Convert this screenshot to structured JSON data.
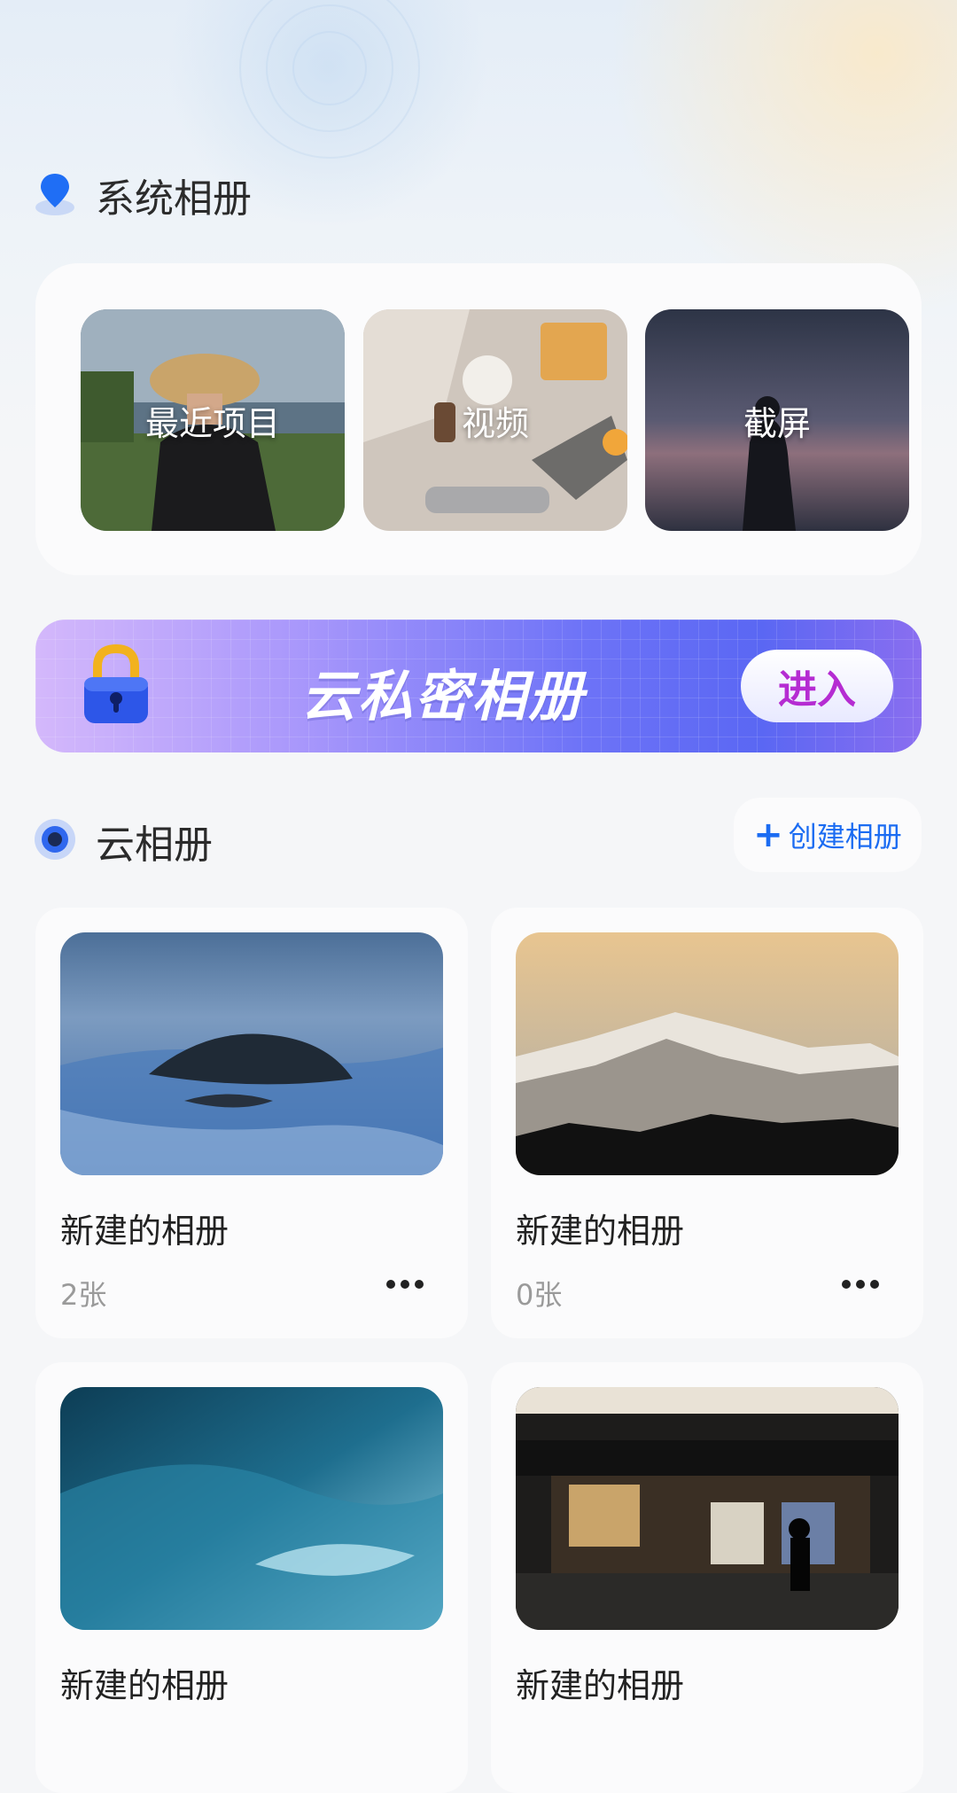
{
  "system_album": {
    "title": "系统相册",
    "tiles": [
      {
        "label": "最近项目"
      },
      {
        "label": "视频"
      },
      {
        "label": "截屏"
      }
    ]
  },
  "private_banner": {
    "title": "云私密相册",
    "enter_label": "进入"
  },
  "cloud_album": {
    "title": "云相册",
    "create_label": "创建相册",
    "albums": [
      {
        "name": "新建的相册",
        "count": "2张"
      },
      {
        "name": "新建的相册",
        "count": "0张"
      },
      {
        "name": "新建的相册",
        "count": ""
      },
      {
        "name": "新建的相册",
        "count": ""
      }
    ]
  },
  "icons": {
    "system": "location-pin-icon",
    "lock": "lock-icon",
    "cloud": "radio-dot-icon",
    "add": "plus-icon",
    "more": "more-dots-icon"
  },
  "colors": {
    "accent": "#1b6cf2",
    "enter_text": "#b52cd2",
    "background": "#f5f6f8"
  }
}
